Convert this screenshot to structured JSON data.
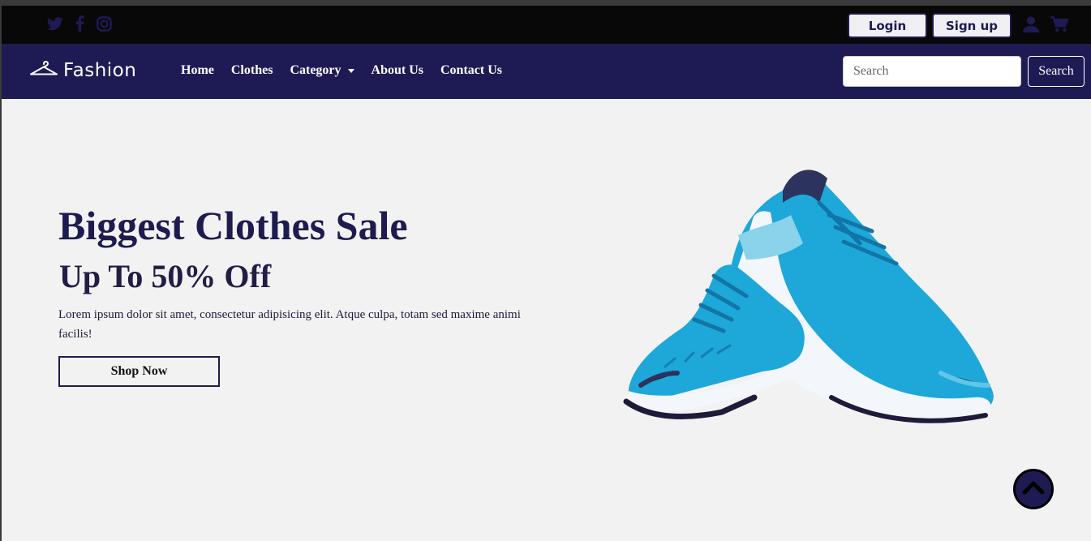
{
  "topbar": {
    "social_icons": [
      "twitter-icon",
      "facebook-icon",
      "instagram-icon"
    ],
    "login_label": "Login",
    "signup_label": "Sign up",
    "user_icon": "user-icon",
    "cart_icon": "cart-icon"
  },
  "navbar": {
    "brand": "Fashion",
    "brand_icon": "hanger-icon",
    "links": [
      "Home",
      "Clothes",
      "Category",
      "About Us",
      "Contact Us"
    ],
    "search_placeholder": "Search",
    "search_button": "Search"
  },
  "hero": {
    "title": "Biggest Clothes Sale",
    "subtitle": "Up To 50% Off",
    "text": "Lorem ipsum dolor sit amet, consectetur adipisicing elit. Atque culpa, totam sed maxime animi facilis!",
    "button": "Shop Now",
    "image": "sneakers-image"
  },
  "scroll_top_icon": "chevron-up-icon",
  "colors": {
    "navy": "#1e1b54",
    "topbar": "#080808",
    "background": "#f2f2f2",
    "shoe_blue": "#1ea7d9"
  }
}
